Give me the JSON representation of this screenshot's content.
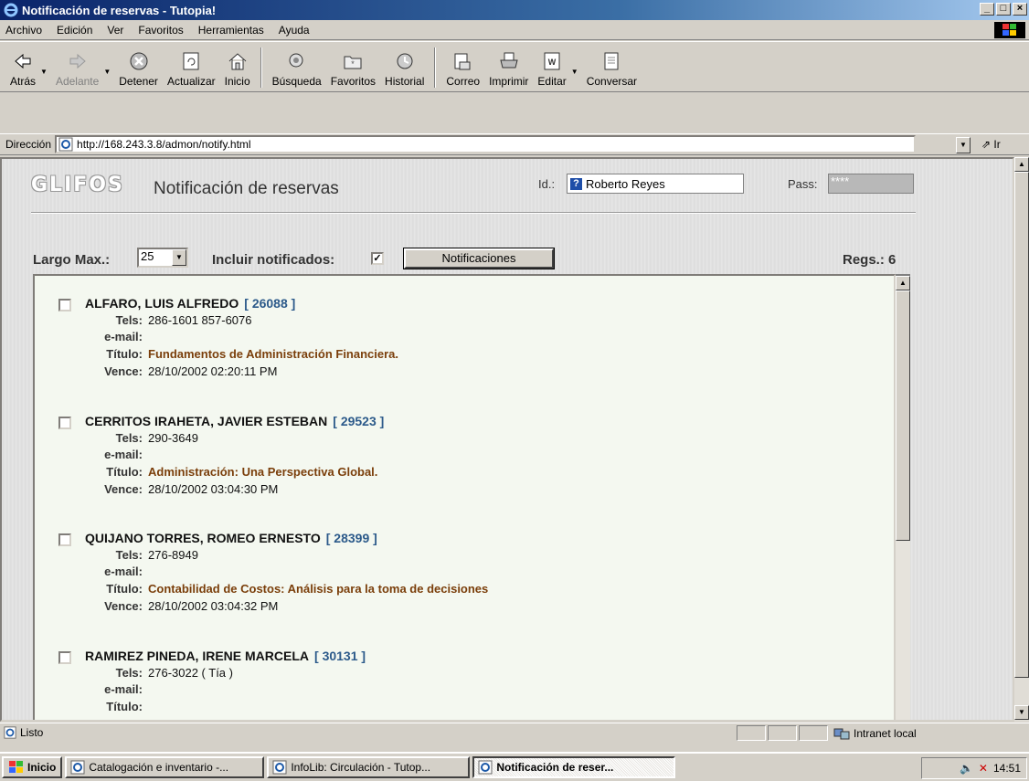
{
  "window": {
    "title": "Notificación de reservas - Tutopia!"
  },
  "menu": [
    "Archivo",
    "Edición",
    "Ver",
    "Favoritos",
    "Herramientas",
    "Ayuda"
  ],
  "toolbar": {
    "back": "Atrás",
    "forward": "Adelante",
    "stop": "Detener",
    "refresh": "Actualizar",
    "home": "Inicio",
    "search": "Búsqueda",
    "favorites": "Favoritos",
    "history": "Historial",
    "mail": "Correo",
    "print": "Imprimir",
    "edit": "Editar",
    "discuss": "Conversar"
  },
  "address": {
    "label": "Dirección",
    "url": "http://168.243.3.8/admon/notify.html",
    "go": "Ir"
  },
  "page": {
    "logo": "GLIFOS",
    "title": "Notificación de reservas",
    "id_label": "Id.:",
    "id_value": "Roberto Reyes",
    "pass_label": "Pass:",
    "pass_value": "****",
    "max_label": "Largo Max.:",
    "max_value": "25",
    "include_label": "Incluir notificados:",
    "notify_button": "Notificaciones",
    "regs": "Regs.: 6"
  },
  "labels": {
    "tels": "Tels:",
    "email": "e-mail:",
    "titulo": "Título:",
    "vence": "Vence:"
  },
  "entries": [
    {
      "name": "ALFARO, LUIS ALFREDO",
      "code": "[ 26088 ]",
      "tels": "286-1601  857-6076",
      "email": "",
      "titulo": "Fundamentos de Administración Financiera.",
      "vence": "28/10/2002 02:20:11 PM"
    },
    {
      "name": "CERRITOS IRAHETA, JAVIER ESTEBAN",
      "code": "[ 29523 ]",
      "tels": "290-3649",
      "email": "",
      "titulo": "Administración: Una Perspectiva Global.",
      "vence": "28/10/2002 03:04:30 PM"
    },
    {
      "name": "QUIJANO TORRES, ROMEO ERNESTO",
      "code": "[ 28399 ]",
      "tels": "276-8949",
      "email": "",
      "titulo": "Contabilidad de Costos: Análisis para la toma de decisiones",
      "vence": "28/10/2002 03:04:32 PM"
    },
    {
      "name": "RAMIREZ PINEDA, IRENE MARCELA",
      "code": "[ 30131 ]",
      "tels": "276-3022 ( Tía )",
      "email": "",
      "titulo": "",
      "vence": ""
    }
  ],
  "status": {
    "text": "Listo",
    "zone": "Intranet local"
  },
  "taskbar": {
    "start": "Inicio",
    "items": [
      "Catalogación e inventario -...",
      "InfoLib: Circulación - Tutop...",
      "Notificación de reser..."
    ],
    "clock": "14:51"
  },
  "colors": {
    "title_accent": "#7a3e0a",
    "code_accent": "#2c5a8a",
    "titlebar": "#0a246a"
  }
}
